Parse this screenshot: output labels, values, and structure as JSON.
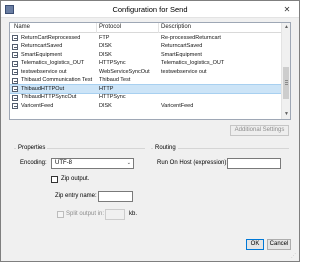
{
  "window": {
    "title": "Configuration for Send",
    "close_symbol": "✕"
  },
  "table": {
    "columns": [
      "Name",
      "Protocol",
      "Description"
    ],
    "rows": [
      {
        "name": "ReturnCartReprocessed",
        "protocol": "FTP",
        "description": "Re-processedReturncart"
      },
      {
        "name": "ReturncartSaved",
        "protocol": "DISK",
        "description": "ReturncartSaved"
      },
      {
        "name": "SmartEquipment",
        "protocol": "DISK",
        "description": "SmartEquipment"
      },
      {
        "name": "Telematics_logistics_OUT",
        "protocol": "HTTPSync",
        "description": "Telematics_logistics_OUT"
      },
      {
        "name": "testwebservice out",
        "protocol": "WebServiceSyncOut",
        "description": "testwebservice out"
      },
      {
        "name": "Thibaud Communication Test",
        "protocol": "Thibaud Test",
        "description": ""
      },
      {
        "name": "ThibaudHTTPOut",
        "protocol": "HTTP",
        "description": ""
      },
      {
        "name": "ThibaudHTTPSyncOut",
        "protocol": "HTTPSync",
        "description": ""
      },
      {
        "name": "VaricentFeed",
        "protocol": "DISK",
        "description": "VaricentFeed"
      }
    ],
    "selected_index": 6
  },
  "additional_settings_label": "Additional Settings",
  "properties": {
    "title": "Properties",
    "encoding_label": "Encoding:",
    "encoding_value": "UTF-8",
    "zip_output_label": "Zip output.",
    "zip_output_checked": false,
    "zip_entry_label": "Zip entry name:",
    "zip_entry_value": "",
    "split_label": "Split output in:",
    "split_value": "",
    "split_unit": "kb."
  },
  "routing": {
    "title": "Routing",
    "run_on_host_label": "Run On Host (expression):",
    "run_on_host_value": ""
  },
  "buttons": {
    "ok": "OK",
    "cancel": "Cancel"
  }
}
